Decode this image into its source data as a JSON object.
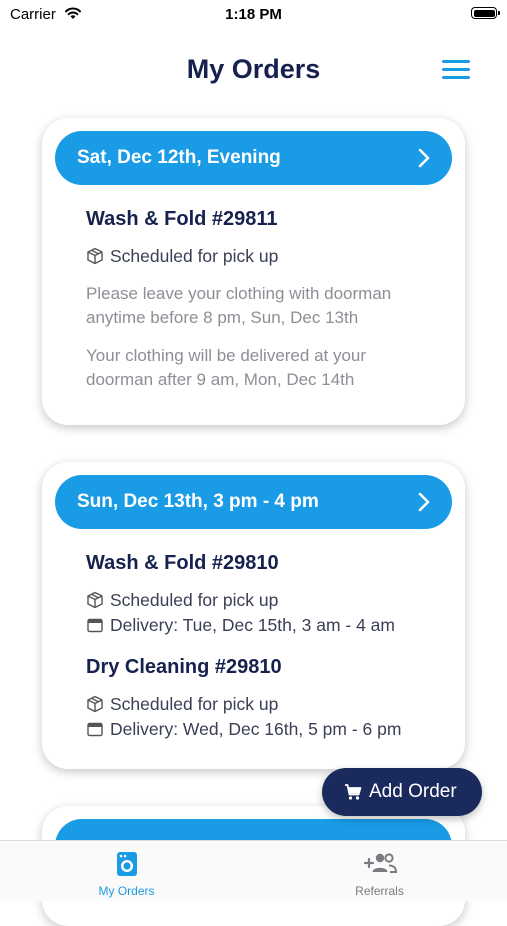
{
  "status_bar": {
    "carrier": "Carrier",
    "time": "1:18 PM"
  },
  "header": {
    "title": "My Orders",
    "menu_icon": "hamburger-menu-icon"
  },
  "orders": [
    {
      "date_label": "Sat, Dec 12th, Evening",
      "items": [
        {
          "title": "Wash & Fold #29811",
          "status": "Scheduled for pick up"
        }
      ],
      "notes": [
        "Please leave your clothing with doorman anytime before 8 pm, Sun, Dec 13th",
        "Your clothing will be delivered at your doorman after 9 am, Mon, Dec 14th"
      ]
    },
    {
      "date_label": "Sun, Dec 13th, 3 pm - 4 pm",
      "items": [
        {
          "title": "Wash & Fold #29810",
          "status": "Scheduled for pick up",
          "delivery": "Delivery: Tue, Dec 15th, 3 am - 4 am"
        },
        {
          "title": "Dry Cleaning #29810",
          "status": "Scheduled for pick up",
          "delivery": "Delivery: Wed, Dec 16th, 5 pm - 6 pm"
        }
      ]
    }
  ],
  "fab": {
    "label": "Add Order",
    "icon": "cart-icon"
  },
  "tabs": [
    {
      "label": "My Orders",
      "icon": "washing-machine-icon",
      "active": true
    },
    {
      "label": "Referrals",
      "icon": "add-people-icon",
      "active": false
    }
  ],
  "colors": {
    "accent": "#1a9be6",
    "navy": "#16214e",
    "fab": "#1b2a5c",
    "muted": "#8e8e96"
  }
}
